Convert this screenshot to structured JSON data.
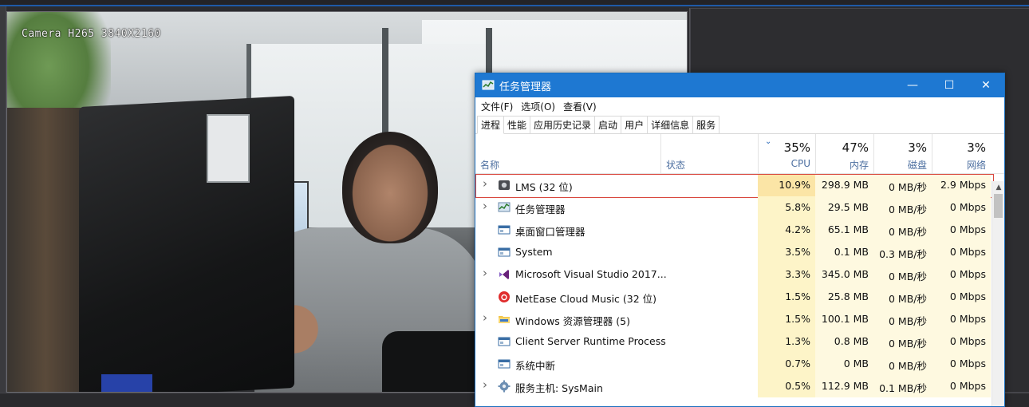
{
  "camera": {
    "overlay_label": "Camera H265 3840X2160"
  },
  "task_manager": {
    "title": "任务管理器",
    "controls": {
      "minimize": "—",
      "maximize": "☐",
      "close": "✕"
    },
    "menu": [
      "文件(F)",
      "选项(O)",
      "查看(V)"
    ],
    "tabs": [
      "进程",
      "性能",
      "应用历史记录",
      "启动",
      "用户",
      "详细信息",
      "服务"
    ],
    "active_tab": "进程",
    "columns": {
      "name": "名称",
      "status": "状态",
      "cpu": {
        "pct": "35%",
        "label": "CPU"
      },
      "mem": {
        "pct": "47%",
        "label": "内存"
      },
      "disk": {
        "pct": "3%",
        "label": "磁盘"
      },
      "net": {
        "pct": "3%",
        "label": "网络"
      }
    },
    "sort_indicator": "⌄",
    "colors": {
      "titlebar": "#1e78d2",
      "cpu_high": "#fbe5a6",
      "cpu_low": "#fdf4c8",
      "cell": "#fef9e0",
      "highlight_border": "#d9493f"
    },
    "processes": [
      {
        "name": "LMS (32 位)",
        "expandable": true,
        "icon": "lms-app-icon",
        "cpu": "10.9%",
        "mem": "298.9 MB",
        "disk": "0 MB/秒",
        "net": "2.9 Mbps",
        "highlighted": true
      },
      {
        "name": "任务管理器",
        "expandable": true,
        "icon": "task-manager-icon",
        "cpu": "5.8%",
        "mem": "29.5 MB",
        "disk": "0 MB/秒",
        "net": "0 Mbps"
      },
      {
        "name": "桌面窗口管理器",
        "expandable": false,
        "icon": "window-icon",
        "cpu": "4.2%",
        "mem": "65.1 MB",
        "disk": "0 MB/秒",
        "net": "0 Mbps"
      },
      {
        "name": "System",
        "expandable": false,
        "icon": "window-icon",
        "cpu": "3.5%",
        "mem": "0.1 MB",
        "disk": "0.3 MB/秒",
        "net": "0 Mbps"
      },
      {
        "name": "Microsoft Visual Studio 2017...",
        "expandable": true,
        "icon": "visual-studio-icon",
        "cpu": "3.3%",
        "mem": "345.0 MB",
        "disk": "0 MB/秒",
        "net": "0 Mbps"
      },
      {
        "name": "NetEase Cloud Music (32 位)",
        "expandable": false,
        "icon": "netease-music-icon",
        "cpu": "1.5%",
        "mem": "25.8 MB",
        "disk": "0 MB/秒",
        "net": "0 Mbps"
      },
      {
        "name": "Windows 资源管理器 (5)",
        "expandable": true,
        "icon": "folder-icon",
        "cpu": "1.5%",
        "mem": "100.1 MB",
        "disk": "0 MB/秒",
        "net": "0 Mbps"
      },
      {
        "name": "Client Server Runtime Process",
        "expandable": false,
        "icon": "window-icon",
        "cpu": "1.3%",
        "mem": "0.8 MB",
        "disk": "0 MB/秒",
        "net": "0 Mbps"
      },
      {
        "name": "系统中断",
        "expandable": false,
        "icon": "window-icon",
        "cpu": "0.7%",
        "mem": "0 MB",
        "disk": "0 MB/秒",
        "net": "0 Mbps"
      },
      {
        "name": "服务主机: SysMain",
        "expandable": true,
        "icon": "gear-icon",
        "cpu": "0.5%",
        "mem": "112.9 MB",
        "disk": "0.1 MB/秒",
        "net": "0 Mbps"
      }
    ]
  }
}
